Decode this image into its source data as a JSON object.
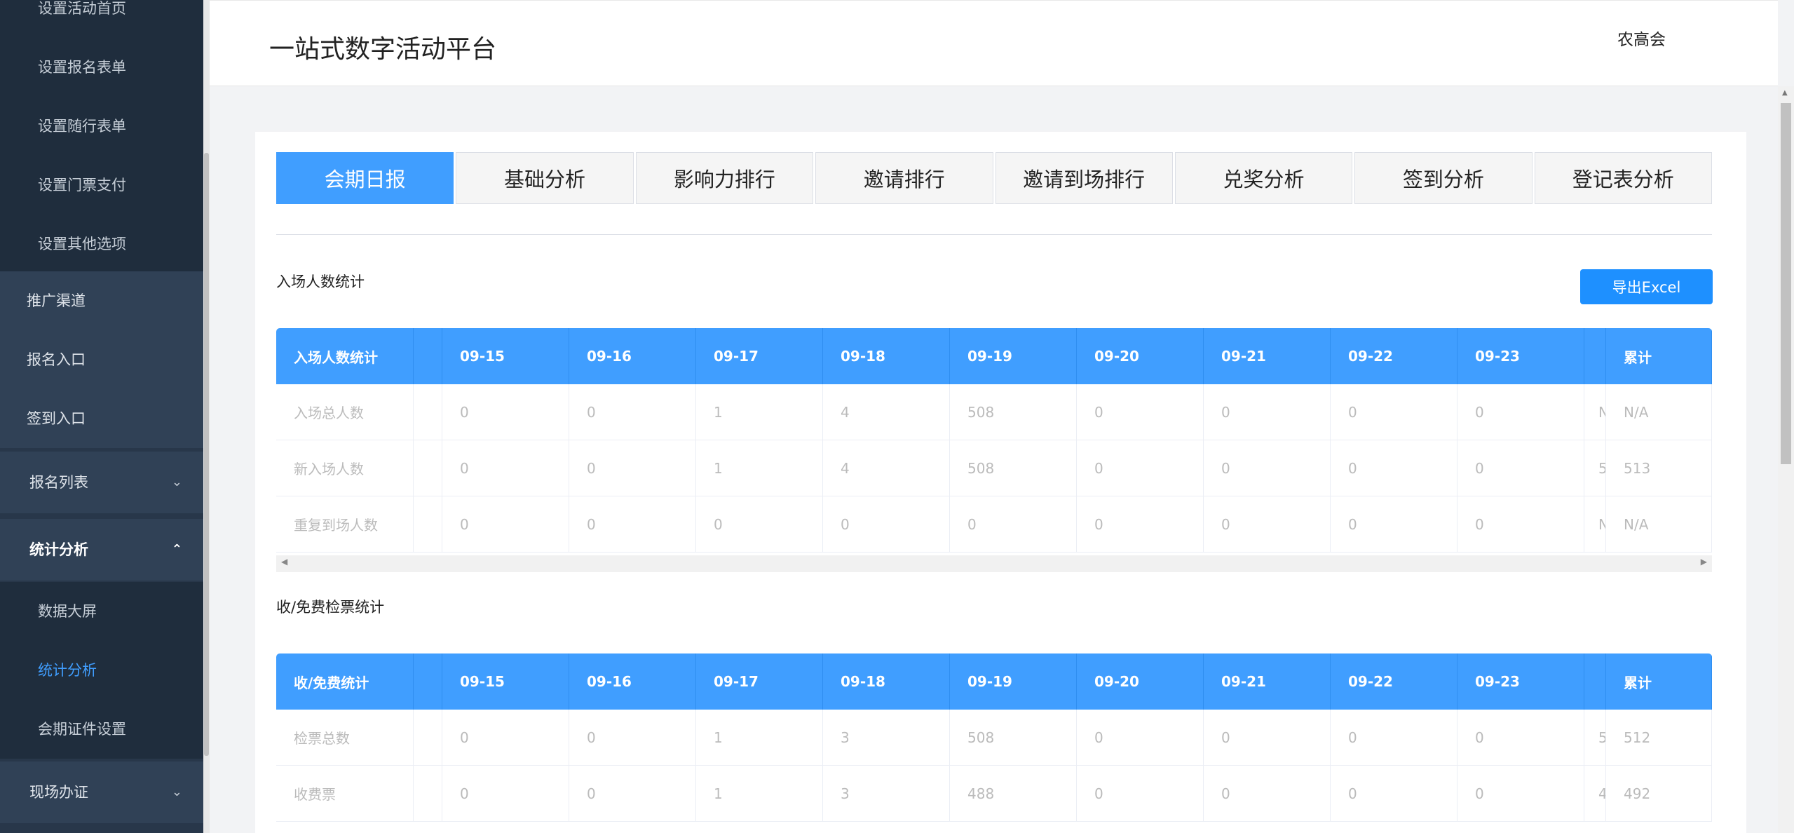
{
  "sidebar": {
    "sub_items_top": [
      "设置活动首页",
      "设置报名表单",
      "设置随行表单",
      "设置门票支付",
      "设置其他选项"
    ],
    "items": [
      "推广渠道",
      "报名入口",
      "签到入口",
      "报名列表"
    ],
    "stat_label": "统计分析",
    "stat_children": [
      "数据大屏",
      "统计分析",
      "会期证件设置"
    ],
    "last_item": "现场办证"
  },
  "header": {
    "title": "一站式数字活动平台",
    "user": "农高会"
  },
  "tabs": [
    "会期日报",
    "基础分析",
    "影响力排行",
    "邀请排行",
    "邀请到场排行",
    "兑奖分析",
    "签到分析",
    "登记表分析"
  ],
  "active_tab": 0,
  "section1": {
    "title": "入场人数统计",
    "export_label": "导出Excel",
    "table": {
      "columns": [
        "入场人数统计",
        "",
        "09-15",
        "09-16",
        "09-17",
        "09-18",
        "09-19",
        "09-20",
        "09-21",
        "09-22",
        "09-23",
        "",
        "累计"
      ],
      "rows": [
        [
          "入场总人数",
          "",
          "0",
          "0",
          "1",
          "4",
          "508",
          "0",
          "0",
          "0",
          "0",
          "N",
          "N/A"
        ],
        [
          "新入场人数",
          "",
          "0",
          "0",
          "1",
          "4",
          "508",
          "0",
          "0",
          "0",
          "0",
          "5",
          "513"
        ],
        [
          "重复到场人数",
          "",
          "0",
          "0",
          "0",
          "0",
          "0",
          "0",
          "0",
          "0",
          "0",
          "N",
          "N/A"
        ]
      ]
    }
  },
  "section2": {
    "title": "收/免费检票统计",
    "table": {
      "columns": [
        "收/免费统计",
        "",
        "09-15",
        "09-16",
        "09-17",
        "09-18",
        "09-19",
        "09-20",
        "09-21",
        "09-22",
        "09-23",
        "",
        "累计"
      ],
      "rows": [
        [
          "检票总数",
          "",
          "0",
          "0",
          "1",
          "3",
          "508",
          "0",
          "0",
          "0",
          "0",
          "5",
          "512"
        ],
        [
          "收费票",
          "",
          "0",
          "0",
          "1",
          "3",
          "488",
          "0",
          "0",
          "0",
          "0",
          "4",
          "492"
        ]
      ]
    }
  },
  "colors": {
    "accent": "#409eff",
    "sidebar": "#304156",
    "sidebar_dark": "#1f2d3d"
  }
}
